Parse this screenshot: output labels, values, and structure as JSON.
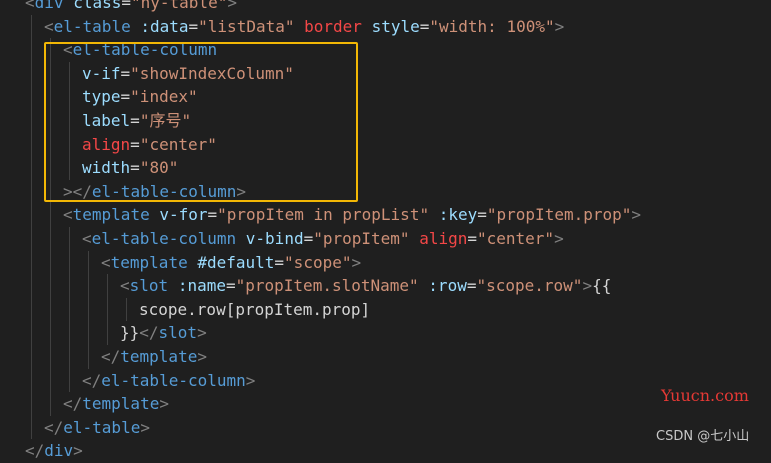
{
  "colors": {
    "tag": "#569cd6",
    "attr": "#9cdcfe",
    "string": "#ce9178",
    "attr_highlight": "#f44747",
    "punct": "#808080",
    "text": "#d4d4d4",
    "highlight_box": "#f2b705"
  },
  "code_lines": [
    {
      "indent": 1,
      "tokens": [
        [
          "p",
          "<"
        ],
        [
          "t",
          "div"
        ],
        [
          "x",
          " "
        ],
        [
          "a",
          "class"
        ],
        [
          "x",
          "="
        ],
        [
          "s",
          "\"hy-table\""
        ],
        [
          "p",
          ">"
        ]
      ]
    },
    {
      "indent": 2,
      "tokens": [
        [
          "p",
          "<"
        ],
        [
          "t",
          "el-table"
        ],
        [
          "x",
          " "
        ],
        [
          "a",
          ":data"
        ],
        [
          "x",
          "="
        ],
        [
          "s",
          "\"listData\""
        ],
        [
          "x",
          " "
        ],
        [
          "r",
          "border"
        ],
        [
          "x",
          " "
        ],
        [
          "a",
          "style"
        ],
        [
          "x",
          "="
        ],
        [
          "s",
          "\"width: 100%\""
        ],
        [
          "p",
          ">"
        ]
      ]
    },
    {
      "indent": 3,
      "tokens": [
        [
          "p",
          "<"
        ],
        [
          "t",
          "el-table-column"
        ]
      ]
    },
    {
      "indent": 4,
      "tokens": [
        [
          "a",
          "v-if"
        ],
        [
          "x",
          "="
        ],
        [
          "s",
          "\"showIndexColumn\""
        ]
      ]
    },
    {
      "indent": 4,
      "tokens": [
        [
          "a",
          "type"
        ],
        [
          "x",
          "="
        ],
        [
          "s",
          "\"index\""
        ]
      ]
    },
    {
      "indent": 4,
      "tokens": [
        [
          "a",
          "label"
        ],
        [
          "x",
          "="
        ],
        [
          "s",
          "\"序号\""
        ]
      ]
    },
    {
      "indent": 4,
      "tokens": [
        [
          "r",
          "align"
        ],
        [
          "x",
          "="
        ],
        [
          "s",
          "\"center\""
        ]
      ]
    },
    {
      "indent": 4,
      "tokens": [
        [
          "a",
          "width"
        ],
        [
          "x",
          "="
        ],
        [
          "s",
          "\"80\""
        ]
      ]
    },
    {
      "indent": 3,
      "tokens": [
        [
          "p",
          "></"
        ],
        [
          "t",
          "el-table-column"
        ],
        [
          "p",
          ">"
        ]
      ]
    },
    {
      "indent": 3,
      "tokens": [
        [
          "p",
          "<"
        ],
        [
          "t",
          "template"
        ],
        [
          "x",
          " "
        ],
        [
          "a",
          "v-for"
        ],
        [
          "x",
          "="
        ],
        [
          "s",
          "\"propItem in propList\""
        ],
        [
          "x",
          " "
        ],
        [
          "a",
          ":key"
        ],
        [
          "x",
          "="
        ],
        [
          "s",
          "\"propItem.prop\""
        ],
        [
          "p",
          ">"
        ]
      ]
    },
    {
      "indent": 4,
      "tokens": [
        [
          "p",
          "<"
        ],
        [
          "t",
          "el-table-column"
        ],
        [
          "x",
          " "
        ],
        [
          "a",
          "v-bind"
        ],
        [
          "x",
          "="
        ],
        [
          "s",
          "\"propItem\""
        ],
        [
          "x",
          " "
        ],
        [
          "r",
          "align"
        ],
        [
          "x",
          "="
        ],
        [
          "s",
          "\"center\""
        ],
        [
          "p",
          ">"
        ]
      ]
    },
    {
      "indent": 5,
      "tokens": [
        [
          "p",
          "<"
        ],
        [
          "t",
          "template"
        ],
        [
          "x",
          " "
        ],
        [
          "a",
          "#default"
        ],
        [
          "x",
          "="
        ],
        [
          "s",
          "\"scope\""
        ],
        [
          "p",
          ">"
        ]
      ]
    },
    {
      "indent": 6,
      "tokens": [
        [
          "p",
          "<"
        ],
        [
          "t",
          "slot"
        ],
        [
          "x",
          " "
        ],
        [
          "a",
          ":name"
        ],
        [
          "x",
          "="
        ],
        [
          "s",
          "\"propItem.slotName\""
        ],
        [
          "x",
          " "
        ],
        [
          "a",
          ":row"
        ],
        [
          "x",
          "="
        ],
        [
          "s",
          "\"scope.row\""
        ],
        [
          "p",
          ">"
        ],
        [
          "x",
          "{{"
        ]
      ]
    },
    {
      "indent": 7,
      "tokens": [
        [
          "x",
          "scope.row[propItem.prop]"
        ]
      ]
    },
    {
      "indent": 6,
      "tokens": [
        [
          "x",
          "}}"
        ],
        [
          "p",
          "</"
        ],
        [
          "t",
          "slot"
        ],
        [
          "p",
          ">"
        ]
      ]
    },
    {
      "indent": 5,
      "tokens": [
        [
          "p",
          "</"
        ],
        [
          "t",
          "template"
        ],
        [
          "p",
          ">"
        ]
      ]
    },
    {
      "indent": 4,
      "tokens": [
        [
          "p",
          "</"
        ],
        [
          "t",
          "el-table-column"
        ],
        [
          "p",
          ">"
        ]
      ]
    },
    {
      "indent": 3,
      "tokens": [
        [
          "p",
          "</"
        ],
        [
          "t",
          "template"
        ],
        [
          "p",
          ">"
        ]
      ]
    },
    {
      "indent": 2,
      "tokens": [
        [
          "p",
          "</"
        ],
        [
          "t",
          "el-table"
        ],
        [
          "p",
          ">"
        ]
      ]
    },
    {
      "indent": 1,
      "tokens": [
        [
          "p",
          "</"
        ],
        [
          "t",
          "div"
        ],
        [
          "p",
          ">"
        ]
      ]
    }
  ],
  "watermark": {
    "site": "Yuucn.com",
    "author": "CSDN @七小山"
  }
}
